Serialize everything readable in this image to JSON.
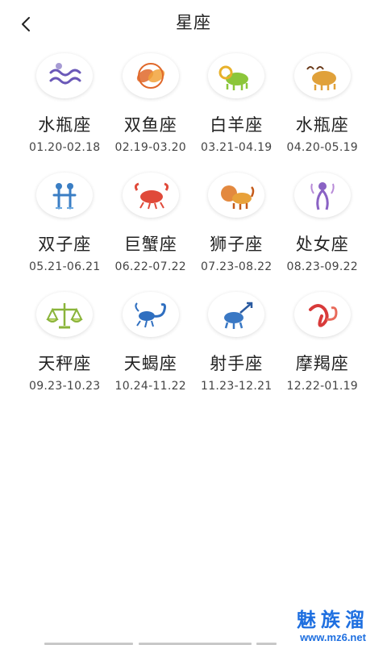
{
  "header": {
    "title": "星座"
  },
  "signs": [
    {
      "name": "水瓶座",
      "dates": "01.20-02.18",
      "icon": "aquarius-icon",
      "color": "#6a58b8"
    },
    {
      "name": "双鱼座",
      "dates": "02.19-03.20",
      "icon": "pisces-icon",
      "color": "#e0682a"
    },
    {
      "name": "白羊座",
      "dates": "03.21-04.19",
      "icon": "aries-icon",
      "color": "#8cc63a"
    },
    {
      "name": "水瓶座",
      "dates": "04.20-05.19",
      "icon": "taurus-icon",
      "color": "#e0a13a"
    },
    {
      "name": "双子座",
      "dates": "05.21-06.21",
      "icon": "gemini-icon",
      "color": "#3a7ec4"
    },
    {
      "name": "巨蟹座",
      "dates": "06.22-07.22",
      "icon": "cancer-icon",
      "color": "#e04a3a"
    },
    {
      "name": "狮子座",
      "dates": "07.23-08.22",
      "icon": "leo-icon",
      "color": "#e07c2a"
    },
    {
      "name": "处女座",
      "dates": "08.23-09.22",
      "icon": "virgo-icon",
      "color": "#8a62c4"
    },
    {
      "name": "天秤座",
      "dates": "09.23-10.23",
      "icon": "libra-icon",
      "color": "#8ab43a"
    },
    {
      "name": "天蝎座",
      "dates": "10.24-11.22",
      "icon": "scorpio-icon",
      "color": "#2f6fc0"
    },
    {
      "name": "射手座",
      "dates": "11.23-12.21",
      "icon": "sagittarius-icon",
      "color": "#3a78c4"
    },
    {
      "name": "摩羯座",
      "dates": "12.22-01.19",
      "icon": "capricorn-icon",
      "color": "#d83a3a"
    }
  ],
  "watermark": {
    "brand": "魅族溜",
    "url": "www.mz6.net"
  }
}
